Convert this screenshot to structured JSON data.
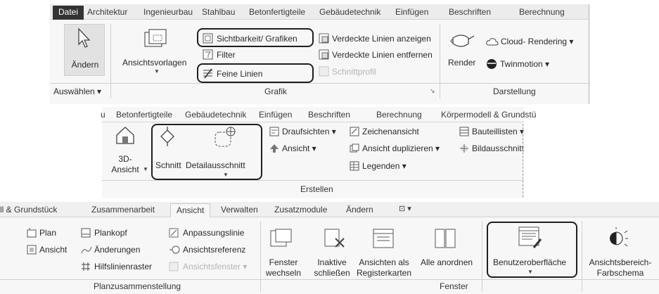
{
  "panel1": {
    "tabs": [
      "Datei",
      "Architektur",
      "Ingenieurbau",
      "Stahlbau",
      "Betonfertigteile",
      "Gebäudetechnik",
      "Einfügen",
      "Beschriften",
      "Berechnung"
    ],
    "aendern_label": "Ändern",
    "auswaehlen_label": "Auswählen ▾",
    "ansichtsvorlagen_label": "Ansichtsvorlagen",
    "sichtbarkeit_label": "Sichtbarkeit/ Grafiken",
    "filter_label": "Filter",
    "feine_linien_label": "Feine Linien",
    "verdeckte_anzeigen_label": "Verdeckte Linien anzeigen",
    "verdeckte_entfernen_label": "Verdeckte Linien entfernen",
    "schnittprofil_label": "Schnittprofil",
    "grafik_group": "Grafik",
    "render_label": "Render",
    "cloud_rendering_label": "Cloud- Rendering ▾",
    "twinmotion_label": "Twinmotion ▾",
    "darstellung_group": "Darstellung"
  },
  "panel2": {
    "tabs": [
      "u",
      "Betonfertigteile",
      "Gebäudetechnik",
      "Einfügen",
      "Beschriften",
      "Berechnung",
      "Körpermodell & Grundstü"
    ],
    "ansicht3d_line1": "3D-",
    "ansicht3d_line2": "Ansicht",
    "schnitt_label": "Schnitt",
    "detail_label": "Detailausschnitt",
    "draufsichten_label": "Draufsichten ▾",
    "ansicht_label": "Ansicht ▾",
    "zeichenansicht_label": "Zeichenansicht",
    "ansicht_duplizieren_label": "Ansicht duplizieren ▾",
    "legenden_label": "Legenden ▾",
    "bauteillisten_label": "Bauteillisten ▾",
    "bildausschnitt_label": "Bildausschnitt",
    "erstellen_group": "Erstellen"
  },
  "panel3": {
    "tabs": [
      "ll & Grundstück",
      "Zusammenarbeit",
      "Ansicht",
      "Verwalten",
      "Zusatzmodule",
      "Ändern"
    ],
    "plan_label": "Plan",
    "ansicht_label": "Ansicht",
    "plankopf_label": "Plankopf",
    "aenderungen_label": "Änderungen",
    "hilfslinienraster_label": "Hilfslinienraster",
    "anpassungslinie_label": "Anpassungslinie",
    "ansichtsreferenz_label": "Ansichtsreferenz",
    "ansichtsfenster_label": "Ansichtsfenster ▾",
    "planzusammenstellung_group": "Planzusammenstellung",
    "fenster_wechseln_line1": "Fenster",
    "fenster_wechseln_line2": "wechseln",
    "inaktive_line1": "Inaktive",
    "inaktive_line2": "schließen",
    "registerkarten_line1": "Ansichten als",
    "registerkarten_line2": "Registerkarten",
    "alle_anordnen_label": "Alle anordnen",
    "fenster_group": "Fenster",
    "benutzeroberflaeche_label": "Benutzeroberfläche",
    "farbschema_line1": "Ansichtsbereich-",
    "farbschema_line2": "Farbschema"
  }
}
